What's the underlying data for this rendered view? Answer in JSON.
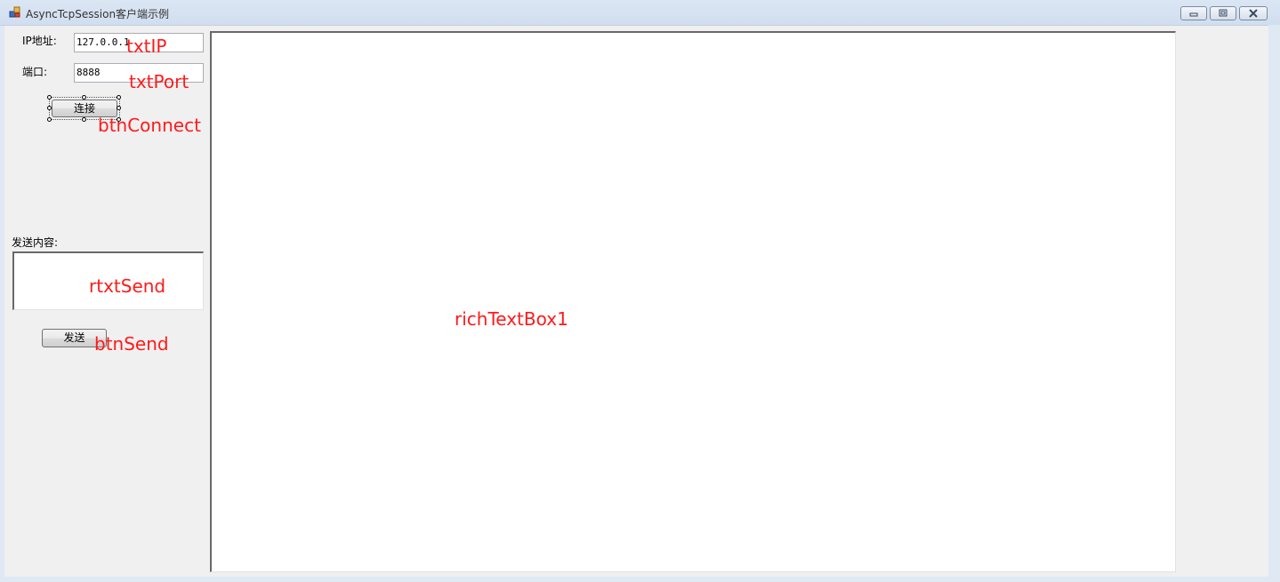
{
  "window": {
    "title": "AsyncTcpSession客户端示例",
    "controls": {
      "minimize_icon": "minimize-icon",
      "restore_icon": "restore-icon",
      "close_icon": "close-icon"
    }
  },
  "form": {
    "ip_label": "IP地址:",
    "ip_value": "127.0.0.1",
    "port_label": "端口:",
    "port_value": "8888",
    "connect_label": "连接",
    "send_content_label": "发送内容:",
    "send_content_value": "",
    "send_label": "发送",
    "log_value": ""
  },
  "annotations": {
    "txtIP": "txtIP",
    "txtPort": "txtPort",
    "btnConnect": "btnConnect",
    "rtxtSend": "rtxtSend",
    "btnSend": "btnSend",
    "richTextBox1": "richTextBox1"
  },
  "colors": {
    "annotation": "#ff1a1a",
    "client_background": "#f0f0f0",
    "frame": "#dfe8f3"
  }
}
